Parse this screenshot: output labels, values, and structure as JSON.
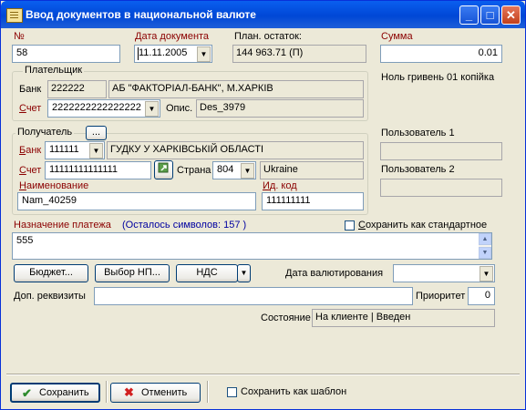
{
  "window": {
    "title": "Ввод документов в национальной валюте"
  },
  "header": {
    "number_label": "№",
    "number_value": "58",
    "date_label": "Дата документа",
    "date_value": "11.11.2005",
    "plan_label": "План. остаток:",
    "plan_value": "144 963.71 (П)",
    "sum_label": "Сумма",
    "sum_value": "0.01",
    "sum_words": "Ноль гривень 01 копійка"
  },
  "payer": {
    "legend": "Плательщик",
    "bank_label": "Банк",
    "bank_code": "222222",
    "bank_name": "АБ \"ФАКТОРІАЛ-БАНК\",  М.ХАРКІВ",
    "account_label": "Счет",
    "account_value": "2222222222222222",
    "desc_label": "Опис.",
    "desc_value": "Des_3979"
  },
  "recipient": {
    "legend": "Получатель",
    "browse_label": "...",
    "bank_label": "Банк",
    "bank_code": "111111",
    "bank_name": "ГУДКУ У ХАРКІВСЬКІЙ ОБЛАСТІ",
    "account_label": "Счет",
    "account_value": "11111111111111",
    "country_label": "Страна",
    "country_code": "804",
    "country_name": "Ukraine",
    "name_label": "Наименование",
    "name_value": "Nam_40259",
    "idcode_label": "Ид. код",
    "idcode_value": "111111111"
  },
  "users": {
    "user1_label": "Пользователь 1",
    "user2_label": "Пользователь 2"
  },
  "purpose": {
    "label": "Назначение платежа",
    "remaining": "(Осталось символов: 157 )",
    "value": "555",
    "save_standard_label": "Сохранить как стандартное"
  },
  "actions": {
    "budget_label": "Бюджет...",
    "np_label": "Выбор НП...",
    "vat_label": "НДС",
    "value_date_label": "Дата валютирования",
    "value_date_value": ""
  },
  "extra": {
    "req_label": "Доп. реквизиты",
    "req_value": "",
    "priority_label": "Приоритет",
    "priority_value": "0",
    "state_label": "Состояние",
    "state_value": "На клиенте | Введен"
  },
  "footer": {
    "save_label": "Сохранить",
    "cancel_label": "Отменить",
    "save_template_label": "Сохранить как шаблон"
  },
  "colors": {
    "accent_red": "#8B0000",
    "link_blue": "#0000A0",
    "titlebar": "#0047D6"
  }
}
